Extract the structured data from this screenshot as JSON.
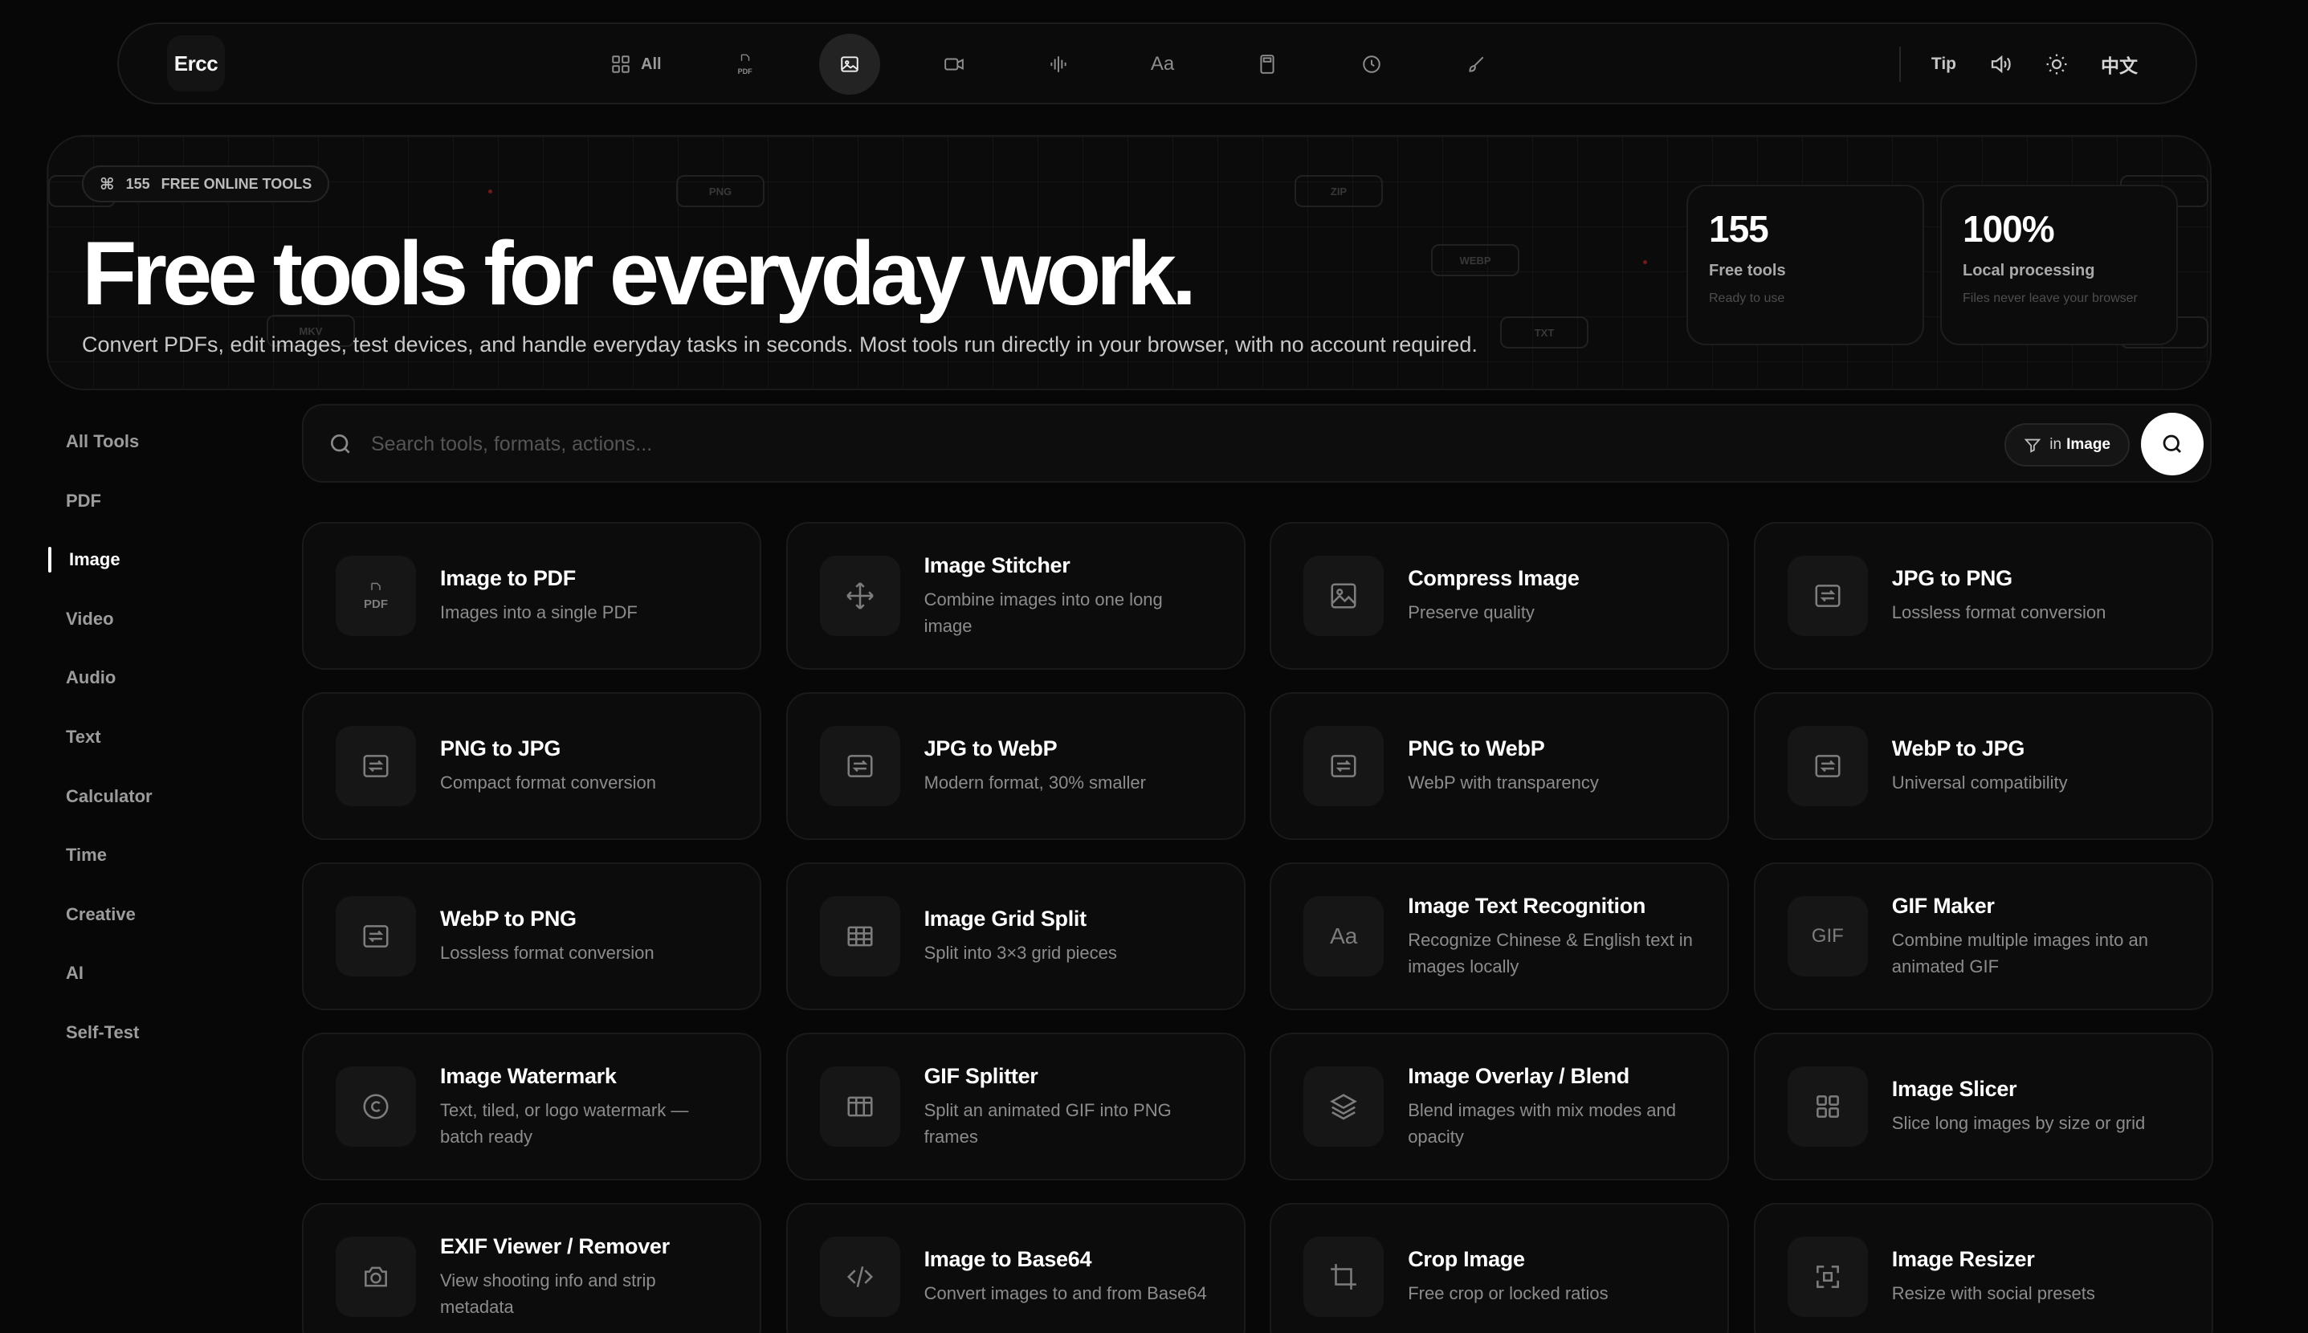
{
  "app": {
    "logo": "Ercc"
  },
  "nav": {
    "categories": [
      {
        "id": "all",
        "label": "All",
        "icon": "grid-icon"
      },
      {
        "id": "pdf",
        "label": "PDF",
        "icon": "pdf-icon"
      },
      {
        "id": "image",
        "label": "",
        "icon": "image-icon",
        "active": true
      },
      {
        "id": "video",
        "label": "",
        "icon": "video-icon"
      },
      {
        "id": "audio",
        "label": "",
        "icon": "audio-wave-icon"
      },
      {
        "id": "text",
        "label": "Aa",
        "icon": "text-icon"
      },
      {
        "id": "calculator",
        "label": "",
        "icon": "calculator-icon"
      },
      {
        "id": "time",
        "label": "",
        "icon": "clock-icon"
      },
      {
        "id": "creative",
        "label": "",
        "icon": "brush-icon"
      }
    ],
    "tip_label": "Tip",
    "language_label": "中文"
  },
  "hero": {
    "badge_count": "155",
    "badge_label": "FREE ONLINE TOOLS",
    "title": "Free tools for everyday work.",
    "description": "Convert PDFs, edit images, test devices, and handle everyday tasks in seconds. Most tools run directly in your browser, with no account required.",
    "floating_chips": [
      "PNG",
      "ZIP",
      "WEBP",
      "TXT",
      "MKV"
    ],
    "stats": [
      {
        "value": "155",
        "label": "Free tools",
        "sub": "Ready to use"
      },
      {
        "value": "100%",
        "label": "Local processing",
        "sub": "Files never leave your browser"
      }
    ]
  },
  "sidebar": {
    "items": [
      {
        "label": "All Tools"
      },
      {
        "label": "PDF"
      },
      {
        "label": "Image",
        "active": true
      },
      {
        "label": "Video"
      },
      {
        "label": "Audio"
      },
      {
        "label": "Text"
      },
      {
        "label": "Calculator"
      },
      {
        "label": "Time"
      },
      {
        "label": "Creative"
      },
      {
        "label": "AI"
      },
      {
        "label": "Self-Test"
      }
    ]
  },
  "search": {
    "placeholder": "Search tools, formats, actions...",
    "value": "",
    "filter_prefix": "in",
    "filter_category": "Image"
  },
  "tools": [
    {
      "title": "Image to PDF",
      "desc": "Images into a single PDF",
      "icon": "pdf-icon"
    },
    {
      "title": "Image Stitcher",
      "desc": "Combine images into one long image",
      "icon": "move-icon"
    },
    {
      "title": "Compress Image",
      "desc": "Preserve quality",
      "icon": "image-icon"
    },
    {
      "title": "JPG to PNG",
      "desc": "Lossless format conversion",
      "icon": "convert-icon"
    },
    {
      "title": "PNG to JPG",
      "desc": "Compact format conversion",
      "icon": "convert-icon"
    },
    {
      "title": "JPG to WebP",
      "desc": "Modern format, 30% smaller",
      "icon": "convert-icon"
    },
    {
      "title": "PNG to WebP",
      "desc": "WebP with transparency",
      "icon": "convert-icon"
    },
    {
      "title": "WebP to JPG",
      "desc": "Universal compatibility",
      "icon": "convert-icon"
    },
    {
      "title": "WebP to PNG",
      "desc": "Lossless format conversion",
      "icon": "convert-icon"
    },
    {
      "title": "Image Grid Split",
      "desc": "Split into 3×3 grid pieces",
      "icon": "table-grid-icon"
    },
    {
      "title": "Image Text Recognition",
      "desc": "Recognize Chinese & English text in images locally",
      "icon": "text-icon"
    },
    {
      "title": "GIF Maker",
      "desc": "Combine multiple images into an animated GIF",
      "icon": "gif-icon"
    },
    {
      "title": "Image Watermark",
      "desc": "Text, tiled, or logo watermark — batch ready",
      "icon": "copyright-icon"
    },
    {
      "title": "GIF Splitter",
      "desc": "Split an animated GIF into PNG frames",
      "icon": "film-frames-icon"
    },
    {
      "title": "Image Overlay / Blend",
      "desc": "Blend images with mix modes and opacity",
      "icon": "layers-icon"
    },
    {
      "title": "Image Slicer",
      "desc": "Slice long images by size or grid",
      "icon": "slice-grid-icon"
    },
    {
      "title": "EXIF Viewer / Remover",
      "desc": "View shooting info and strip metadata",
      "icon": "camera-icon"
    },
    {
      "title": "Image to Base64",
      "desc": "Convert images to and from Base64",
      "icon": "code-icon"
    },
    {
      "title": "Crop Image",
      "desc": "Free crop or locked ratios",
      "icon": "crop-icon"
    },
    {
      "title": "Image Resizer",
      "desc": "Resize with social presets",
      "icon": "resize-icon"
    }
  ]
}
